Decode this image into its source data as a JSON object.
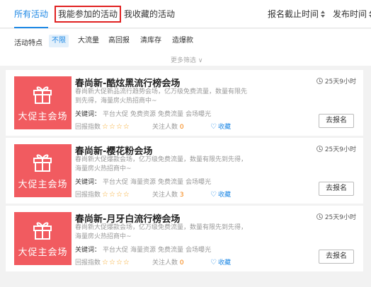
{
  "tabs": [
    {
      "label": "所有活动"
    },
    {
      "label": "我能参加的活动"
    },
    {
      "label": "我收藏的活动"
    }
  ],
  "sort": {
    "deadline_label": "报名截止时间",
    "publish_label": "发布时间"
  },
  "filter": {
    "label": "活动特点",
    "chips": [
      "不限",
      "大流量",
      "高回报",
      "清库存",
      "造爆款"
    ],
    "active_index": 0,
    "more_label": "更多筛选 ∨"
  },
  "colors": {
    "accent": "#1e88e5",
    "thumb_bg": "#f15b60",
    "star": "#f5a623",
    "highlight_border": "#e02020"
  },
  "cards": [
    {
      "thumb_text": "大促主会场",
      "title": "春尚新-酷炫黑流行榜会场",
      "desc": "春尚新大促新品流行趋势会场，亿万级免费流量，数量有限先到先得，海量房火热招商中~",
      "keywords_label": "关键词：",
      "keywords": [
        "平台大促",
        "免费资源",
        "免费流量",
        "会场曝光"
      ],
      "rate_label": "回报指数",
      "stars": "☆☆☆☆",
      "follow_label": "关注人数",
      "follow_count": "0",
      "fav_label": "收藏",
      "time_left": "25天9小时",
      "signup_label": "去报名"
    },
    {
      "thumb_text": "大促主会场",
      "title": "春尚新-樱花粉会场",
      "desc": "春尚新大促爆款会场，亿万级免费流量，数量有限先到先得，海量房火热招商中~",
      "keywords_label": "关键词：",
      "keywords": [
        "平台大促",
        "海量资源",
        "免费流量",
        "会场曝光"
      ],
      "rate_label": "回报指数",
      "stars": "☆☆☆☆",
      "follow_label": "关注人数",
      "follow_count": "3",
      "fav_label": "收藏",
      "time_left": "25天9小时",
      "signup_label": "去报名"
    },
    {
      "thumb_text": "大促主会场",
      "title": "春尚新-月牙白流行榜会场",
      "desc": "春尚新大促爆款会场，亿万级免费流量，数量有限先到先得，海量房火热招商中~",
      "keywords_label": "关键词：",
      "keywords": [
        "平台大促",
        "海量资源",
        "免费流量",
        "会场曝光"
      ],
      "rate_label": "回报指数",
      "stars": "☆☆☆☆",
      "follow_label": "关注人数",
      "follow_count": "0",
      "fav_label": "收藏",
      "time_left": "25天9小时",
      "signup_label": "去报名"
    }
  ]
}
